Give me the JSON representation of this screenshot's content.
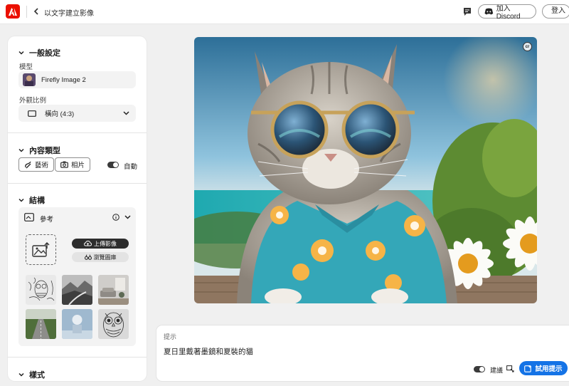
{
  "header": {
    "title": "以文字建立影像",
    "discord_label": "加入 Discord",
    "signin_label": "登入"
  },
  "general": {
    "heading": "一般設定",
    "model_label": "模型",
    "model_value": "Firefly Image 2",
    "aspect_label": "外觀比例",
    "aspect_value": "橫向 (4:3)"
  },
  "content_type": {
    "heading": "內容類型",
    "art_label": "藝術",
    "photo_label": "相片",
    "auto_label": "自動"
  },
  "structure": {
    "heading": "結構",
    "reference_label": "參考",
    "upload_label": "上傳影像",
    "browse_label": "瀏覽圖庫",
    "thumbnails": [
      "owl-sketch",
      "mountain-road",
      "living-room",
      "highway-field",
      "sphere-pedestal",
      "owl-pattern"
    ]
  },
  "style": {
    "heading": "樣式"
  },
  "prompt": {
    "label": "提示",
    "text": "夏日里戴著墨鏡和夏裝的貓",
    "suggest_label": "建議",
    "generate_label": "試用提示"
  },
  "colors": {
    "accent": "#1473e6",
    "brand": "#eb1000"
  }
}
